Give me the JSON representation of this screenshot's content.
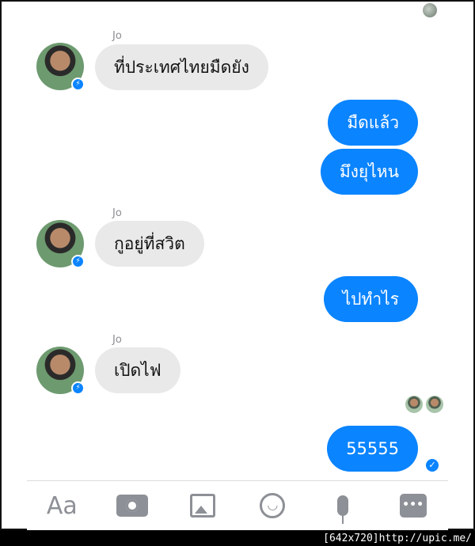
{
  "conversation": {
    "messages": [
      {
        "sender": "Jo",
        "text": "ที่ประเทศไทยมืดยัง",
        "direction": "incoming"
      },
      {
        "text": "มืดแล้ว",
        "direction": "outgoing"
      },
      {
        "text": "มึงยุไหน",
        "direction": "outgoing"
      },
      {
        "sender": "Jo",
        "text": "กูอยู่ที่สวิต",
        "direction": "incoming"
      },
      {
        "text": "ไปทำไร",
        "direction": "outgoing"
      },
      {
        "sender": "Jo",
        "text": "เปิดไฟ",
        "direction": "incoming"
      },
      {
        "text": "55555",
        "direction": "outgoing"
      }
    ]
  },
  "composer": {
    "text_button": "Aa",
    "icons": [
      "camera-icon",
      "image-icon",
      "emoji-icon",
      "microphone-icon",
      "more-icon"
    ]
  },
  "watermark": "[642x720]http://upic.me/",
  "colors": {
    "outgoing_bubble": "#0a84ff",
    "incoming_bubble": "#e9e9ea",
    "icon_gray": "#8d9096"
  }
}
